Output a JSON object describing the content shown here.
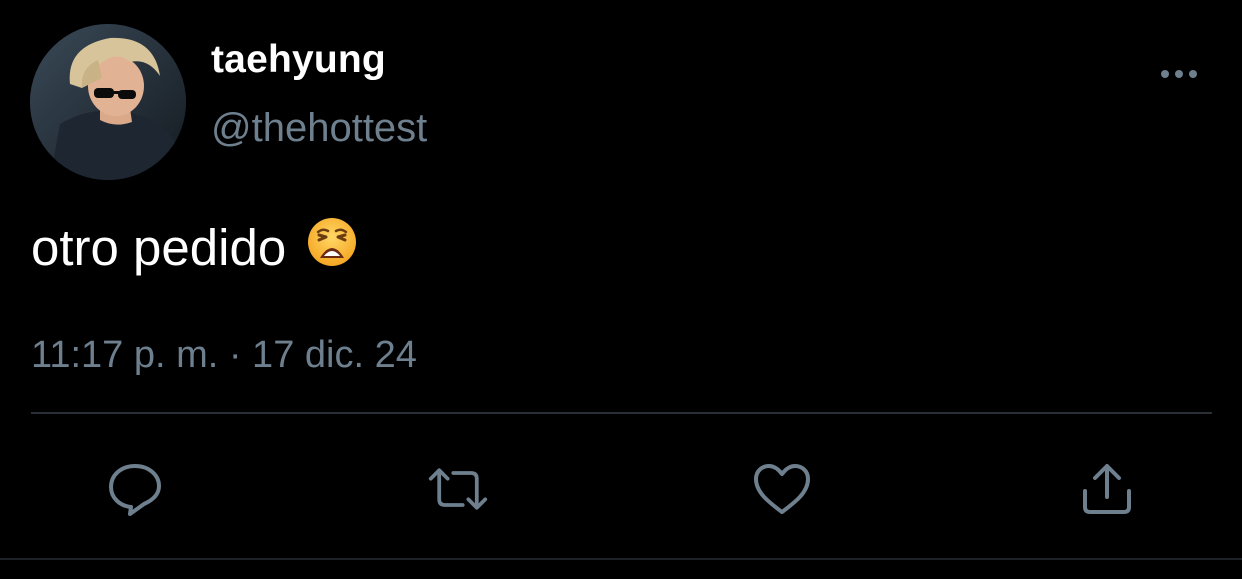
{
  "tweet": {
    "display_name": "taehyung",
    "handle": "@thehottest",
    "text": "otro pedido",
    "emoji": "weary-face",
    "timestamp": "11:17 p. m. · 17 dic. 24"
  },
  "actions": {
    "reply_icon": "reply-icon",
    "retweet_icon": "retweet-icon",
    "like_icon": "heart-icon",
    "share_icon": "share-icon"
  },
  "colors": {
    "background": "#000000",
    "primary_text": "#ffffff",
    "secondary_text": "#6e7f8e",
    "divider": "#2a2f35",
    "icon": "#6e7f8e"
  }
}
